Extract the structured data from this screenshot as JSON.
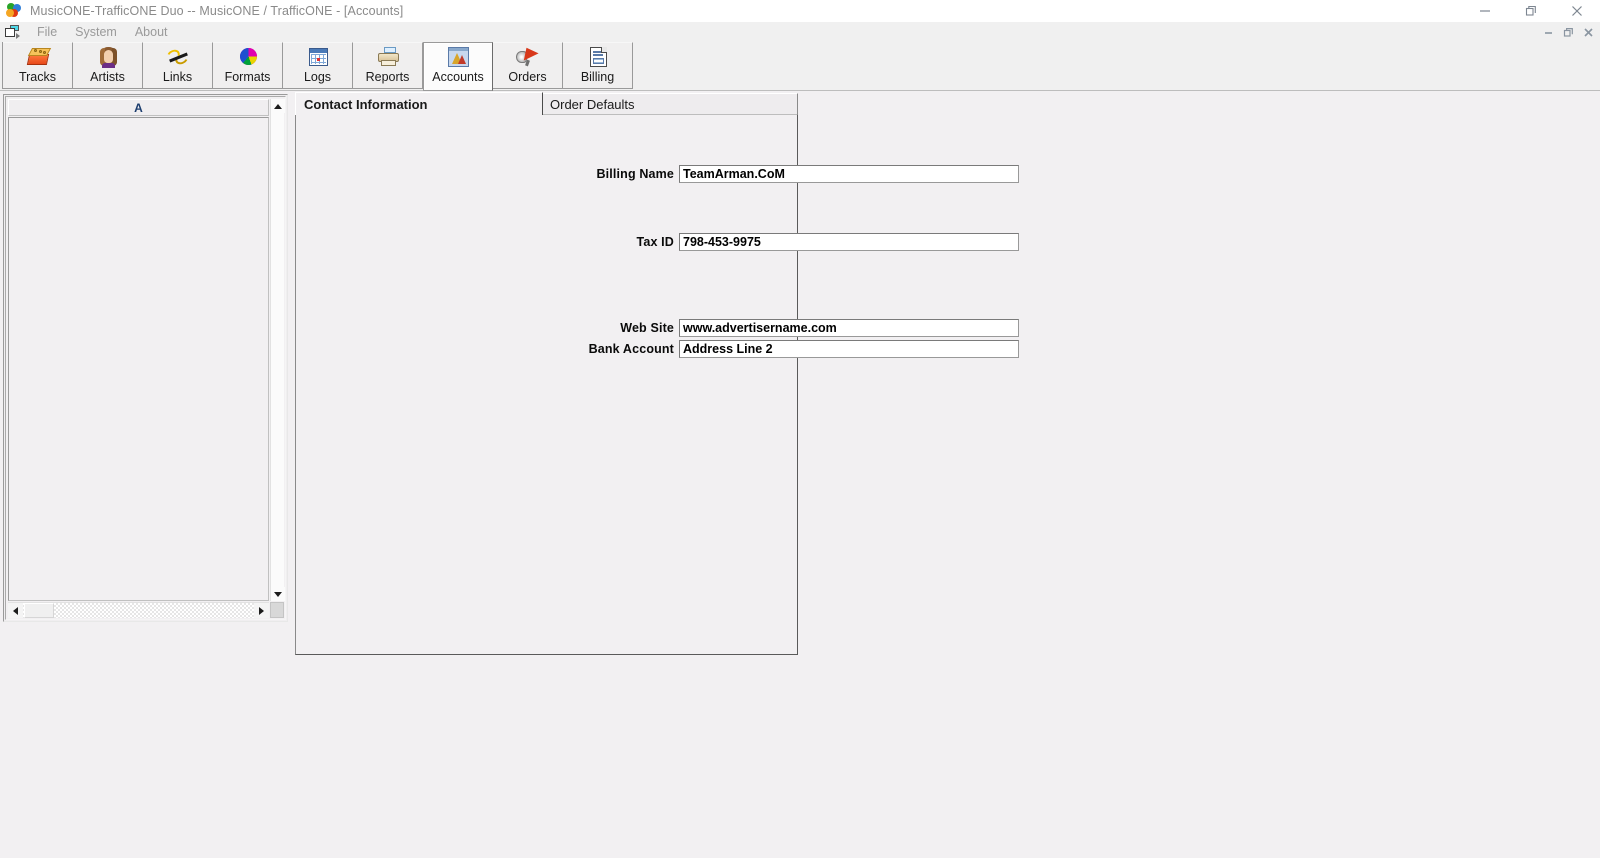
{
  "window": {
    "title": "MusicONE-TrafficONE Duo -- MusicONE / TrafficONE - [Accounts]",
    "app_icon": "music-disc-icon",
    "controls": [
      {
        "name": "minimize",
        "glyph": "—"
      },
      {
        "name": "restore",
        "glyph": "❐"
      },
      {
        "name": "close",
        "glyph": "✕"
      }
    ]
  },
  "menubar": {
    "system_icon": "mdi-restore-icon",
    "items": [
      {
        "label": "File"
      },
      {
        "label": "System"
      },
      {
        "label": "About"
      }
    ],
    "mdi_controls": [
      {
        "name": "mdi-minimize",
        "glyph": "–"
      },
      {
        "name": "mdi-restore",
        "glyph": "❐"
      },
      {
        "name": "mdi-close",
        "glyph": "✕"
      }
    ]
  },
  "toolbar": {
    "active": "Accounts",
    "buttons": [
      {
        "label": "Tracks",
        "icon": "tracks-icon"
      },
      {
        "label": "Artists",
        "icon": "artists-icon"
      },
      {
        "label": "Links",
        "icon": "links-icon"
      },
      {
        "label": "Formats",
        "icon": "formats-icon"
      },
      {
        "label": "Logs",
        "icon": "logs-icon"
      },
      {
        "label": "Reports",
        "icon": "reports-icon"
      },
      {
        "label": "Accounts",
        "icon": "accounts-icon"
      },
      {
        "label": "Orders",
        "icon": "orders-icon"
      },
      {
        "label": "Billing",
        "icon": "billing-icon"
      }
    ]
  },
  "list_panel": {
    "column_header": "A",
    "rows": [],
    "vscroll": {
      "up": "scroll-up-arrow",
      "down": "scroll-down-arrow"
    },
    "hscroll": {
      "left": "scroll-left-arrow",
      "right": "scroll-right-arrow"
    }
  },
  "tabs": [
    {
      "label": "Contact Information",
      "active": true
    },
    {
      "label": "Order Defaults",
      "active": false
    }
  ],
  "form": {
    "fields": [
      {
        "label": "Billing Name",
        "value": "TeamArman.CoM"
      },
      {
        "label": "Tax ID",
        "value": "798-453-9975"
      },
      {
        "label": "Web Site",
        "value": "www.advertisername.com"
      },
      {
        "label": "Bank Account",
        "value": "Address Line 2"
      }
    ]
  },
  "colors": {
    "window_bg": "#f2f0f2",
    "titlebar_bg": "#ffffff",
    "titlebar_text": "#8a8a8a",
    "toolbar_bg": "#f0f0f0",
    "field_bg": "#ffffff",
    "label_text": "#0a0a0a",
    "header_text": "#1c3d6e"
  }
}
